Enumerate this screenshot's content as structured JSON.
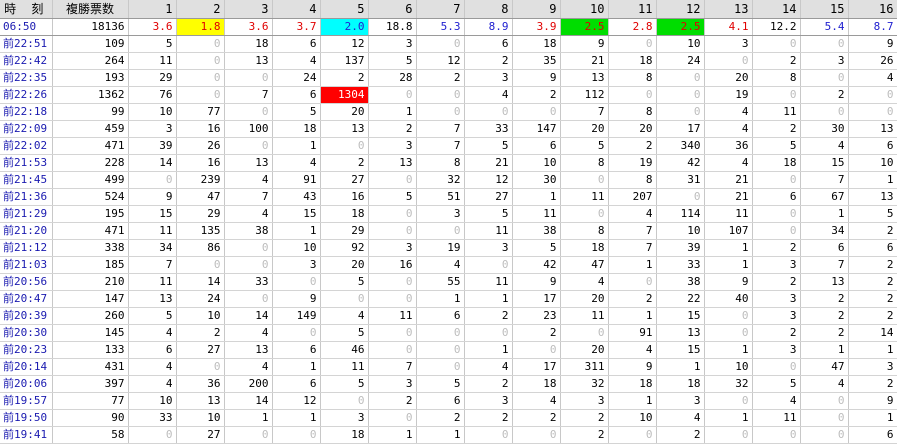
{
  "header": {
    "time_label": "時 刻",
    "total_label": "複勝票数",
    "horses": [
      "1",
      "2",
      "3",
      "4",
      "5",
      "6",
      "7",
      "8",
      "9",
      "10",
      "11",
      "12",
      "13",
      "14",
      "15",
      "16"
    ]
  },
  "colors": {
    "odds_red": "#e00000",
    "odds_blue": "#2020d0",
    "odds_black": "#000000",
    "highlight_yellow": "#ffff00",
    "highlight_cyan": "#00ffff",
    "highlight_green": "#00dd00",
    "highlight_red": "#ff0000",
    "zero_grey": "#bdbdbd",
    "time_blue": "#1a1ab0",
    "header_bg": "#e0e0e0"
  },
  "odds_row": {
    "time": "06:50",
    "total": "18136",
    "cells": [
      {
        "v": "3.6",
        "c": "red"
      },
      {
        "v": "1.8",
        "c": "red",
        "bg": "yellow"
      },
      {
        "v": "3.6",
        "c": "red"
      },
      {
        "v": "3.7",
        "c": "red"
      },
      {
        "v": "2.0",
        "c": "blue",
        "bg": "cyan"
      },
      {
        "v": "18.8",
        "c": "black"
      },
      {
        "v": "5.3",
        "c": "blue"
      },
      {
        "v": "8.9",
        "c": "blue"
      },
      {
        "v": "3.9",
        "c": "red"
      },
      {
        "v": "2.5",
        "c": "red",
        "bg": "green"
      },
      {
        "v": "2.8",
        "c": "red"
      },
      {
        "v": "2.5",
        "c": "red",
        "bg": "green"
      },
      {
        "v": "4.1",
        "c": "red"
      },
      {
        "v": "12.2",
        "c": "black"
      },
      {
        "v": "5.4",
        "c": "blue"
      },
      {
        "v": "8.7",
        "c": "blue"
      }
    ]
  },
  "rows": [
    {
      "time": "前22:51",
      "total": "109",
      "vals": [
        "5",
        "0",
        "18",
        "6",
        "12",
        "3",
        "0",
        "6",
        "18",
        "9",
        "0",
        "10",
        "3",
        "0",
        "0",
        "9"
      ]
    },
    {
      "time": "前22:42",
      "total": "264",
      "vals": [
        "11",
        "0",
        "13",
        "4",
        "137",
        "5",
        "12",
        "2",
        "35",
        "21",
        "18",
        "24",
        "0",
        "2",
        "3",
        "26"
      ]
    },
    {
      "time": "前22:35",
      "total": "193",
      "vals": [
        "29",
        "0",
        "0",
        "24",
        "2",
        "28",
        "2",
        "3",
        "9",
        "13",
        "8",
        "0",
        "20",
        "8",
        "0",
        "4"
      ]
    },
    {
      "time": "前22:26",
      "total": "1362",
      "vals": [
        "76",
        "0",
        "7",
        "6",
        "1304",
        "0",
        "0",
        "4",
        "2",
        "112",
        "0",
        "0",
        "19",
        "0",
        "2",
        "0"
      ]
    },
    {
      "time": "前22:18",
      "total": "99",
      "vals": [
        "10",
        "77",
        "0",
        "5",
        "20",
        "1",
        "0",
        "0",
        "0",
        "7",
        "8",
        "0",
        "4",
        "11",
        "0",
        "0"
      ]
    },
    {
      "time": "前22:09",
      "total": "459",
      "vals": [
        "3",
        "16",
        "100",
        "18",
        "13",
        "2",
        "7",
        "33",
        "147",
        "20",
        "20",
        "17",
        "4",
        "2",
        "30",
        "13"
      ]
    },
    {
      "time": "前22:02",
      "total": "471",
      "vals": [
        "39",
        "26",
        "0",
        "1",
        "0",
        "3",
        "7",
        "5",
        "6",
        "5",
        "2",
        "340",
        "36",
        "5",
        "4",
        "6"
      ]
    },
    {
      "time": "前21:53",
      "total": "228",
      "vals": [
        "14",
        "16",
        "13",
        "4",
        "2",
        "13",
        "8",
        "21",
        "10",
        "8",
        "19",
        "42",
        "4",
        "18",
        "15",
        "10"
      ]
    },
    {
      "time": "前21:45",
      "total": "499",
      "vals": [
        "0",
        "239",
        "4",
        "91",
        "27",
        "0",
        "32",
        "12",
        "30",
        "0",
        "8",
        "31",
        "21",
        "0",
        "7",
        "1"
      ]
    },
    {
      "time": "前21:36",
      "total": "524",
      "vals": [
        "9",
        "47",
        "7",
        "43",
        "16",
        "5",
        "51",
        "27",
        "1",
        "11",
        "207",
        "0",
        "21",
        "6",
        "67",
        "13"
      ]
    },
    {
      "time": "前21:29",
      "total": "195",
      "vals": [
        "15",
        "29",
        "4",
        "15",
        "18",
        "0",
        "3",
        "5",
        "11",
        "0",
        "4",
        "114",
        "11",
        "0",
        "1",
        "5"
      ]
    },
    {
      "time": "前21:20",
      "total": "471",
      "vals": [
        "11",
        "135",
        "38",
        "1",
        "29",
        "0",
        "0",
        "11",
        "38",
        "8",
        "7",
        "10",
        "107",
        "0",
        "34",
        "2"
      ]
    },
    {
      "time": "前21:12",
      "total": "338",
      "vals": [
        "34",
        "86",
        "0",
        "10",
        "92",
        "3",
        "19",
        "3",
        "5",
        "18",
        "7",
        "39",
        "1",
        "2",
        "6",
        "6"
      ]
    },
    {
      "time": "前21:03",
      "total": "185",
      "vals": [
        "7",
        "0",
        "0",
        "3",
        "20",
        "16",
        "4",
        "0",
        "42",
        "47",
        "1",
        "33",
        "1",
        "3",
        "7",
        "2"
      ]
    },
    {
      "time": "前20:56",
      "total": "210",
      "vals": [
        "11",
        "14",
        "33",
        "0",
        "5",
        "0",
        "55",
        "11",
        "9",
        "4",
        "0",
        "38",
        "9",
        "2",
        "13",
        "2"
      ]
    },
    {
      "time": "前20:47",
      "total": "147",
      "vals": [
        "13",
        "24",
        "0",
        "9",
        "0",
        "0",
        "1",
        "1",
        "17",
        "20",
        "2",
        "22",
        "40",
        "3",
        "2",
        "2"
      ]
    },
    {
      "time": "前20:39",
      "total": "260",
      "vals": [
        "5",
        "10",
        "14",
        "149",
        "4",
        "11",
        "6",
        "2",
        "23",
        "11",
        "1",
        "15",
        "0",
        "3",
        "2",
        "2"
      ]
    },
    {
      "time": "前20:30",
      "total": "145",
      "vals": [
        "4",
        "2",
        "4",
        "0",
        "5",
        "0",
        "0",
        "0",
        "2",
        "0",
        "91",
        "13",
        "0",
        "2",
        "2",
        "14"
      ]
    },
    {
      "time": "前20:23",
      "total": "133",
      "vals": [
        "6",
        "27",
        "13",
        "6",
        "46",
        "0",
        "0",
        "1",
        "0",
        "20",
        "4",
        "15",
        "1",
        "3",
        "1",
        "1"
      ]
    },
    {
      "time": "前20:14",
      "total": "431",
      "vals": [
        "4",
        "0",
        "4",
        "1",
        "11",
        "7",
        "0",
        "4",
        "17",
        "311",
        "9",
        "1",
        "10",
        "0",
        "47",
        "3"
      ]
    },
    {
      "time": "前20:06",
      "total": "397",
      "vals": [
        "4",
        "36",
        "200",
        "6",
        "5",
        "3",
        "5",
        "2",
        "18",
        "32",
        "18",
        "18",
        "32",
        "5",
        "4",
        "2"
      ]
    },
    {
      "time": "前19:57",
      "total": "77",
      "vals": [
        "10",
        "13",
        "14",
        "12",
        "0",
        "2",
        "6",
        "3",
        "4",
        "3",
        "1",
        "3",
        "0",
        "4",
        "0",
        "9"
      ]
    },
    {
      "time": "前19:50",
      "total": "90",
      "vals": [
        "33",
        "10",
        "1",
        "1",
        "3",
        "0",
        "2",
        "2",
        "2",
        "2",
        "10",
        "4",
        "1",
        "11",
        "0",
        "1"
      ]
    },
    {
      "time": "前19:41",
      "total": "58",
      "vals": [
        "0",
        "27",
        "0",
        "0",
        "18",
        "1",
        "1",
        "0",
        "0",
        "2",
        "0",
        "2",
        "0",
        "0",
        "0",
        "6"
      ]
    }
  ],
  "highlight_cells": [
    {
      "row": 3,
      "col": 4,
      "bg": "red",
      "fg": "#ffffff"
    }
  ]
}
